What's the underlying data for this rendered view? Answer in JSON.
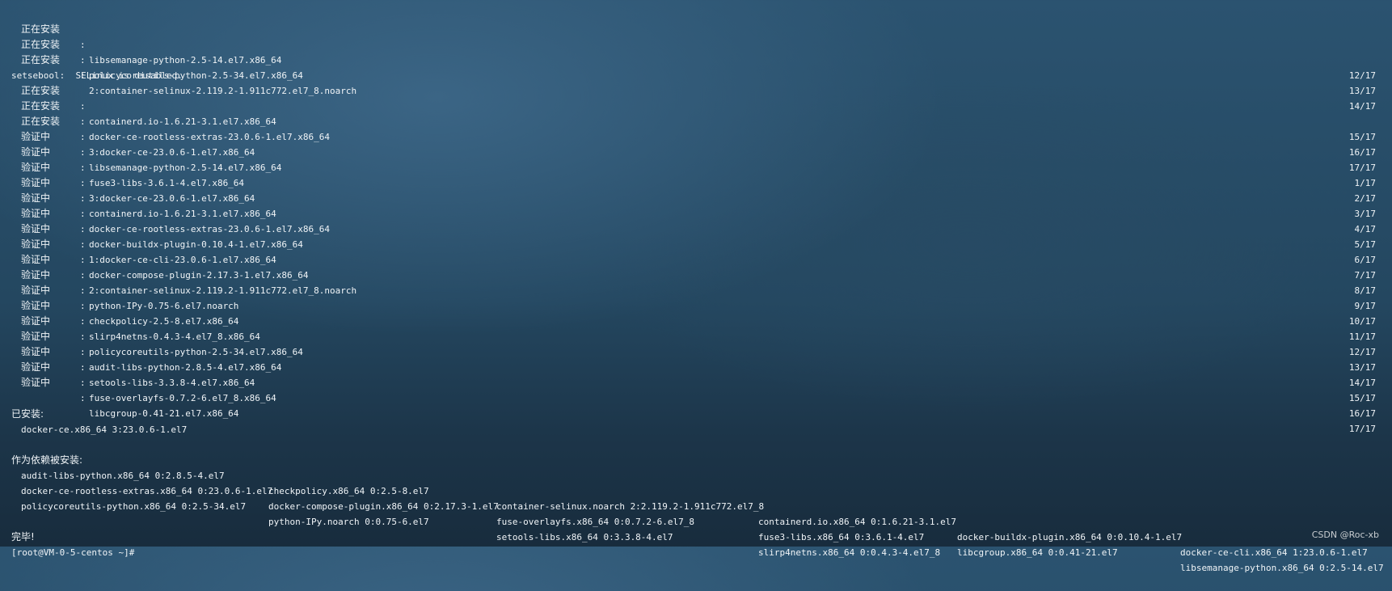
{
  "log": [
    {
      "status": "正在安装",
      "pkg": "libsemanage-python-2.5-14.el7.x86_64",
      "progress": "12/17"
    },
    {
      "status": "正在安装",
      "pkg": "policycoreutils-python-2.5-34.el7.x86_64",
      "progress": "13/17"
    },
    {
      "status": "正在安装",
      "pkg": "2:container-selinux-2.119.2-1.911c772.el7_8.noarch",
      "progress": "14/17"
    },
    {
      "plain": "setsebool:  SELinux is disabled."
    },
    {
      "status": "正在安装",
      "pkg": "containerd.io-1.6.21-3.1.el7.x86_64",
      "progress": "15/17"
    },
    {
      "status": "正在安装",
      "pkg": "docker-ce-rootless-extras-23.0.6-1.el7.x86_64",
      "progress": "16/17"
    },
    {
      "status": "正在安装",
      "pkg": "3:docker-ce-23.0.6-1.el7.x86_64",
      "progress": "17/17"
    },
    {
      "status": "验证中",
      "pkg": "libsemanage-python-2.5-14.el7.x86_64",
      "progress": "1/17"
    },
    {
      "status": "验证中",
      "pkg": "fuse3-libs-3.6.1-4.el7.x86_64",
      "progress": "2/17"
    },
    {
      "status": "验证中",
      "pkg": "3:docker-ce-23.0.6-1.el7.x86_64",
      "progress": "3/17"
    },
    {
      "status": "验证中",
      "pkg": "containerd.io-1.6.21-3.1.el7.x86_64",
      "progress": "4/17"
    },
    {
      "status": "验证中",
      "pkg": "docker-ce-rootless-extras-23.0.6-1.el7.x86_64",
      "progress": "5/17"
    },
    {
      "status": "验证中",
      "pkg": "docker-buildx-plugin-0.10.4-1.el7.x86_64",
      "progress": "6/17"
    },
    {
      "status": "验证中",
      "pkg": "1:docker-ce-cli-23.0.6-1.el7.x86_64",
      "progress": "7/17"
    },
    {
      "status": "验证中",
      "pkg": "docker-compose-plugin-2.17.3-1.el7.x86_64",
      "progress": "8/17"
    },
    {
      "status": "验证中",
      "pkg": "2:container-selinux-2.119.2-1.911c772.el7_8.noarch",
      "progress": "9/17"
    },
    {
      "status": "验证中",
      "pkg": "python-IPy-0.75-6.el7.noarch",
      "progress": "10/17"
    },
    {
      "status": "验证中",
      "pkg": "checkpolicy-2.5-8.el7.x86_64",
      "progress": "11/17"
    },
    {
      "status": "验证中",
      "pkg": "slirp4netns-0.4.3-4.el7_8.x86_64",
      "progress": "12/17"
    },
    {
      "status": "验证中",
      "pkg": "policycoreutils-python-2.5-34.el7.x86_64",
      "progress": "13/17"
    },
    {
      "status": "验证中",
      "pkg": "audit-libs-python-2.8.5-4.el7.x86_64",
      "progress": "14/17"
    },
    {
      "status": "验证中",
      "pkg": "setools-libs-3.3.8-4.el7.x86_64",
      "progress": "15/17"
    },
    {
      "status": "验证中",
      "pkg": "fuse-overlayfs-0.7.2-6.el7_8.x86_64",
      "progress": "16/17"
    },
    {
      "status": "验证中",
      "pkg": "libcgroup-0.41-21.el7.x86_64",
      "progress": "17/17"
    }
  ],
  "installed": {
    "heading": "已安装:",
    "items": [
      "docker-ce.x86_64 3:23.0.6-1.el7"
    ]
  },
  "dependencies": {
    "heading": "作为依赖被安装:",
    "rows": [
      [
        "audit-libs-python.x86_64 0:2.8.5-4.el7",
        "checkpolicy.x86_64 0:2.5-8.el7",
        "container-selinux.noarch 2:2.119.2-1.911c772.el7_8",
        "containerd.io.x86_64 0:1.6.21-3.1.el7",
        "docker-buildx-plugin.x86_64 0:0.10.4-1.el7",
        "docker-ce-cli.x86_64 1:23.0.6-1.el7"
      ],
      [
        "docker-ce-rootless-extras.x86_64 0:23.0.6-1.el7",
        "docker-compose-plugin.x86_64 0:2.17.3-1.el7",
        "fuse-overlayfs.x86_64 0:0.7.2-6.el7_8",
        "fuse3-libs.x86_64 0:3.6.1-4.el7",
        "libcgroup.x86_64 0:0.41-21.el7",
        "libsemanage-python.x86_64 0:2.5-14.el7"
      ],
      [
        "policycoreutils-python.x86_64 0:2.5-34.el7",
        "python-IPy.noarch 0:0.75-6.el7",
        "setools-libs.x86_64 0:3.3.8-4.el7",
        "slirp4netns.x86_64 0:0.4.3-4.el7_8",
        "",
        ""
      ]
    ]
  },
  "done": "完毕!",
  "prompt": "[root@VM-0-5-centos ~]#",
  "watermark": "CSDN @Roc-xb",
  "colors": {
    "text": "#f0f4f7",
    "bg_top": "#2b5370",
    "bg_bottom": "#182c3d"
  }
}
